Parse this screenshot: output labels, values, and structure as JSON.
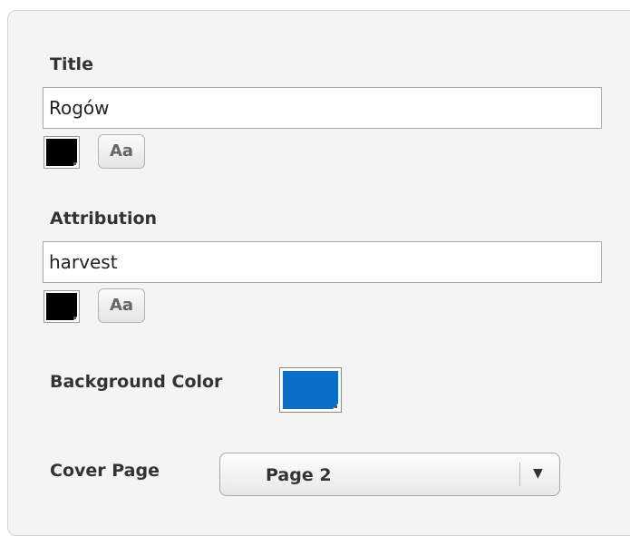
{
  "title_section": {
    "label": "Title",
    "value": "Rogów",
    "text_color": "#000000",
    "font_button_label": "Aa"
  },
  "attribution_section": {
    "label": "Attribution",
    "value": "harvest",
    "text_color": "#000000",
    "font_button_label": "Aa"
  },
  "background_section": {
    "label": "Background Color",
    "color": "#0a6fc8"
  },
  "cover_page_section": {
    "label": "Cover Page",
    "selected": "Page 2"
  },
  "icons": {
    "dropdown_arrow": "chevron-down-icon"
  }
}
